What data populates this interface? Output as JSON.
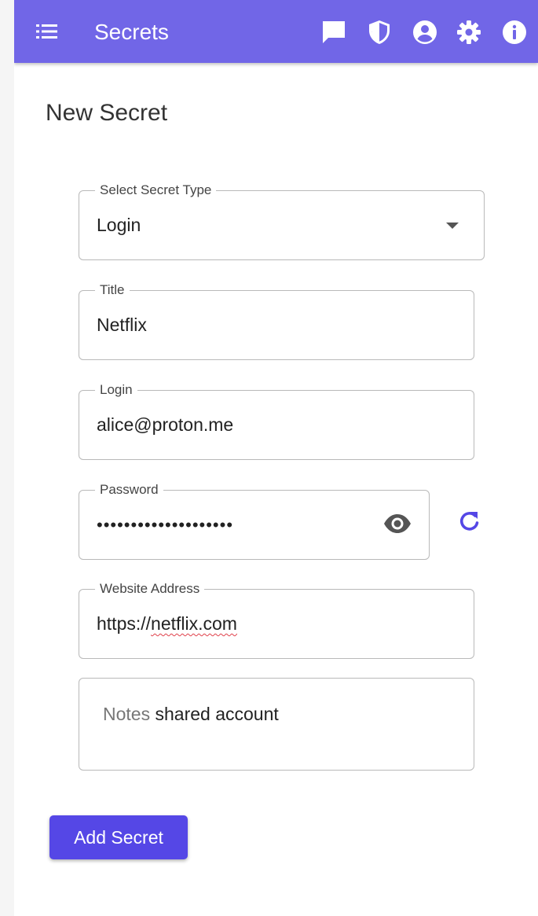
{
  "appbar": {
    "title": "Secrets",
    "icons": [
      "menu-icon",
      "chat-icon",
      "shield-icon",
      "account-icon",
      "gear-icon",
      "info-icon"
    ],
    "background": "#7166e7"
  },
  "page": {
    "heading": "New Secret"
  },
  "form": {
    "secret_type": {
      "label": "Select Secret Type",
      "value": "Login"
    },
    "title": {
      "label": "Title",
      "value": "Netflix"
    },
    "login": {
      "label": "Login",
      "value": "alice@proton.me"
    },
    "password": {
      "label": "Password",
      "masked_value": "••••••••••••••••••••"
    },
    "website": {
      "label": "Website Address",
      "prefix": "https://",
      "domain": "netflix.com"
    },
    "notes": {
      "placeholder": "Notes",
      "value": "shared account"
    },
    "submit_label": "Add Secret",
    "accent": "#5547e6"
  }
}
